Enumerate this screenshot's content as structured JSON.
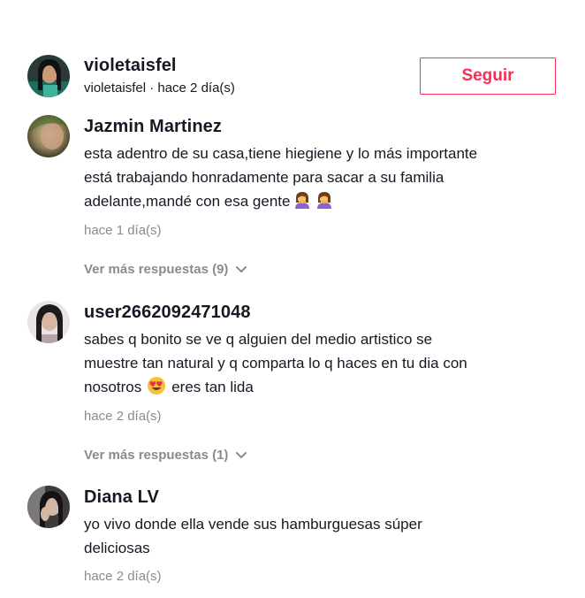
{
  "header": {
    "username": "violetaisfel",
    "meta": "violetaisfel · hace 2 día(s)",
    "follow_label": "Seguir",
    "accent_color": "#fe2c55"
  },
  "comments": [
    {
      "author": "Jazmin Martinez",
      "lines": [
        "esta adentro de su casa,tiene hiegiene y lo más importante",
        "está trabajando honradamente para sacar a su familia",
        "adelante,mandé con esa gente"
      ],
      "emojis": [
        "woman-facepalming-emoji",
        "woman-facepalming-emoji"
      ],
      "time": "hace 1 día(s)",
      "replies_label": "Ver más respuestas (9)"
    },
    {
      "author": "user2662092471048",
      "lines": [
        "sabes q bonito se ve q alguien del medio artistico se",
        "muestre tan natural y q comparta lo q haces en tu dia con",
        "nosotros",
        "eres tan lida"
      ],
      "emojis": [
        "heart-eyes-emoji"
      ],
      "time": "hace 2 día(s)",
      "replies_label": "Ver más respuestas (1)"
    },
    {
      "author": "Diana LV",
      "lines": [
        "yo vivo donde ella vende sus hamburguesas súper",
        "deliciosas"
      ],
      "time": "hace 2 día(s)"
    }
  ],
  "colors": {
    "text": "#161823",
    "muted": "#8a8b91"
  }
}
